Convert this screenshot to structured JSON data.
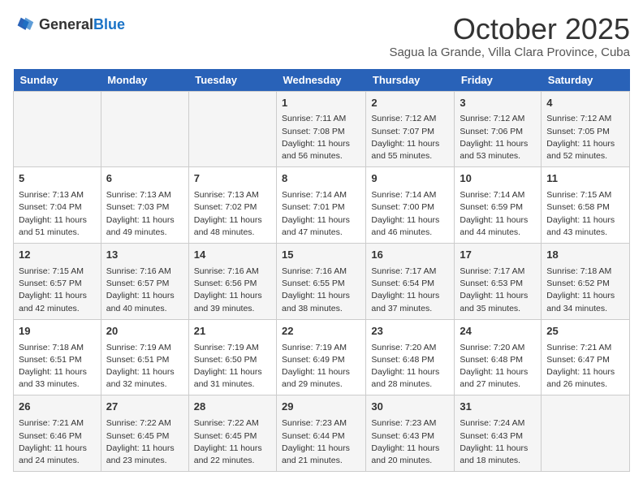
{
  "logo": {
    "general": "General",
    "blue": "Blue"
  },
  "header": {
    "month": "October 2025",
    "location": "Sagua la Grande, Villa Clara Province, Cuba"
  },
  "weekdays": [
    "Sunday",
    "Monday",
    "Tuesday",
    "Wednesday",
    "Thursday",
    "Friday",
    "Saturday"
  ],
  "weeks": [
    [
      {
        "day": "",
        "info": ""
      },
      {
        "day": "",
        "info": ""
      },
      {
        "day": "",
        "info": ""
      },
      {
        "day": "1",
        "info": "Sunrise: 7:11 AM\nSunset: 7:08 PM\nDaylight: 11 hours and 56 minutes."
      },
      {
        "day": "2",
        "info": "Sunrise: 7:12 AM\nSunset: 7:07 PM\nDaylight: 11 hours and 55 minutes."
      },
      {
        "day": "3",
        "info": "Sunrise: 7:12 AM\nSunset: 7:06 PM\nDaylight: 11 hours and 53 minutes."
      },
      {
        "day": "4",
        "info": "Sunrise: 7:12 AM\nSunset: 7:05 PM\nDaylight: 11 hours and 52 minutes."
      }
    ],
    [
      {
        "day": "5",
        "info": "Sunrise: 7:13 AM\nSunset: 7:04 PM\nDaylight: 11 hours and 51 minutes."
      },
      {
        "day": "6",
        "info": "Sunrise: 7:13 AM\nSunset: 7:03 PM\nDaylight: 11 hours and 49 minutes."
      },
      {
        "day": "7",
        "info": "Sunrise: 7:13 AM\nSunset: 7:02 PM\nDaylight: 11 hours and 48 minutes."
      },
      {
        "day": "8",
        "info": "Sunrise: 7:14 AM\nSunset: 7:01 PM\nDaylight: 11 hours and 47 minutes."
      },
      {
        "day": "9",
        "info": "Sunrise: 7:14 AM\nSunset: 7:00 PM\nDaylight: 11 hours and 46 minutes."
      },
      {
        "day": "10",
        "info": "Sunrise: 7:14 AM\nSunset: 6:59 PM\nDaylight: 11 hours and 44 minutes."
      },
      {
        "day": "11",
        "info": "Sunrise: 7:15 AM\nSunset: 6:58 PM\nDaylight: 11 hours and 43 minutes."
      }
    ],
    [
      {
        "day": "12",
        "info": "Sunrise: 7:15 AM\nSunset: 6:57 PM\nDaylight: 11 hours and 42 minutes."
      },
      {
        "day": "13",
        "info": "Sunrise: 7:16 AM\nSunset: 6:57 PM\nDaylight: 11 hours and 40 minutes."
      },
      {
        "day": "14",
        "info": "Sunrise: 7:16 AM\nSunset: 6:56 PM\nDaylight: 11 hours and 39 minutes."
      },
      {
        "day": "15",
        "info": "Sunrise: 7:16 AM\nSunset: 6:55 PM\nDaylight: 11 hours and 38 minutes."
      },
      {
        "day": "16",
        "info": "Sunrise: 7:17 AM\nSunset: 6:54 PM\nDaylight: 11 hours and 37 minutes."
      },
      {
        "day": "17",
        "info": "Sunrise: 7:17 AM\nSunset: 6:53 PM\nDaylight: 11 hours and 35 minutes."
      },
      {
        "day": "18",
        "info": "Sunrise: 7:18 AM\nSunset: 6:52 PM\nDaylight: 11 hours and 34 minutes."
      }
    ],
    [
      {
        "day": "19",
        "info": "Sunrise: 7:18 AM\nSunset: 6:51 PM\nDaylight: 11 hours and 33 minutes."
      },
      {
        "day": "20",
        "info": "Sunrise: 7:19 AM\nSunset: 6:51 PM\nDaylight: 11 hours and 32 minutes."
      },
      {
        "day": "21",
        "info": "Sunrise: 7:19 AM\nSunset: 6:50 PM\nDaylight: 11 hours and 31 minutes."
      },
      {
        "day": "22",
        "info": "Sunrise: 7:19 AM\nSunset: 6:49 PM\nDaylight: 11 hours and 29 minutes."
      },
      {
        "day": "23",
        "info": "Sunrise: 7:20 AM\nSunset: 6:48 PM\nDaylight: 11 hours and 28 minutes."
      },
      {
        "day": "24",
        "info": "Sunrise: 7:20 AM\nSunset: 6:48 PM\nDaylight: 11 hours and 27 minutes."
      },
      {
        "day": "25",
        "info": "Sunrise: 7:21 AM\nSunset: 6:47 PM\nDaylight: 11 hours and 26 minutes."
      }
    ],
    [
      {
        "day": "26",
        "info": "Sunrise: 7:21 AM\nSunset: 6:46 PM\nDaylight: 11 hours and 24 minutes."
      },
      {
        "day": "27",
        "info": "Sunrise: 7:22 AM\nSunset: 6:45 PM\nDaylight: 11 hours and 23 minutes."
      },
      {
        "day": "28",
        "info": "Sunrise: 7:22 AM\nSunset: 6:45 PM\nDaylight: 11 hours and 22 minutes."
      },
      {
        "day": "29",
        "info": "Sunrise: 7:23 AM\nSunset: 6:44 PM\nDaylight: 11 hours and 21 minutes."
      },
      {
        "day": "30",
        "info": "Sunrise: 7:23 AM\nSunset: 6:43 PM\nDaylight: 11 hours and 20 minutes."
      },
      {
        "day": "31",
        "info": "Sunrise: 7:24 AM\nSunset: 6:43 PM\nDaylight: 11 hours and 18 minutes."
      },
      {
        "day": "",
        "info": ""
      }
    ]
  ]
}
